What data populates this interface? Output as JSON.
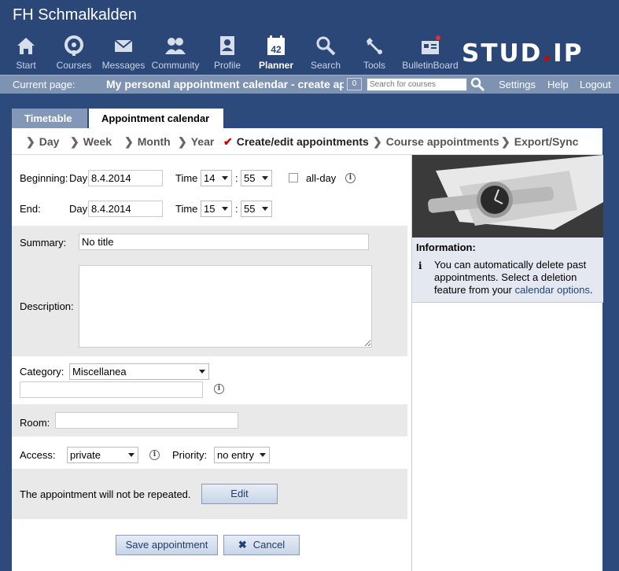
{
  "site_title": "FH Schmalkalden",
  "nav": [
    {
      "label": "Start",
      "icon": "home-icon"
    },
    {
      "label": "Courses",
      "icon": "courses-icon"
    },
    {
      "label": "Messages",
      "icon": "envelope-icon"
    },
    {
      "label": "Community",
      "icon": "community-icon"
    },
    {
      "label": "Profile",
      "icon": "profile-icon"
    },
    {
      "label": "Planner",
      "icon": "calendar-icon",
      "badge": "42",
      "active": true
    },
    {
      "label": "Search",
      "icon": "search-icon"
    },
    {
      "label": "Tools",
      "icon": "wrench-icon"
    },
    {
      "label": "BulletinBoard",
      "icon": "bulletin-board-icon"
    }
  ],
  "logo": {
    "left": "STUD",
    "dot": ".",
    "right": "IP"
  },
  "bar": {
    "current_label": "Current page:",
    "current_title": "My personal appointment calendar - create appo",
    "counter": "0",
    "search_placeholder": "Search for courses",
    "links": [
      "Settings",
      "Help",
      "Logout"
    ]
  },
  "tabs": [
    "Timetable",
    "Appointment calendar"
  ],
  "subnav": [
    "Day",
    "Week",
    "Month",
    "Year",
    "Create/edit appointments",
    "Course appointments",
    "Export/Sync"
  ],
  "form": {
    "beginning_label": "Beginning:",
    "day_label": "Day",
    "begin_day": "8.4.2014",
    "time_label": "Time",
    "begin_hour": "14",
    "begin_min": "55",
    "colon": ":",
    "allday_label": "all-day",
    "end_label": "End:",
    "end_day": "8.4.2014",
    "end_hour": "15",
    "end_min": "55",
    "summary_label": "Summary:",
    "summary_value": "No title",
    "description_label": "Description:",
    "category_label": "Category:",
    "category_value": "Miscellanea",
    "room_label": "Room:",
    "access_label": "Access:",
    "access_value": "private",
    "priority_label": "Priority:",
    "priority_value": "no entry",
    "repeat_text": "The appointment will not be repeated.",
    "edit_button": "Edit",
    "save_button": "Save appointment",
    "cancel_button": "Cancel"
  },
  "sidebar": {
    "info_title": "Information:",
    "info_text": "You can automatically delete past appointments. Select a deletion feature from your ",
    "info_link": "calendar options",
    "info_end": "."
  },
  "colors": {
    "header": "#2a4777",
    "bar": "#7e92b2",
    "grey_section": "#e9e9e9",
    "accent_red": "#cc0000"
  }
}
